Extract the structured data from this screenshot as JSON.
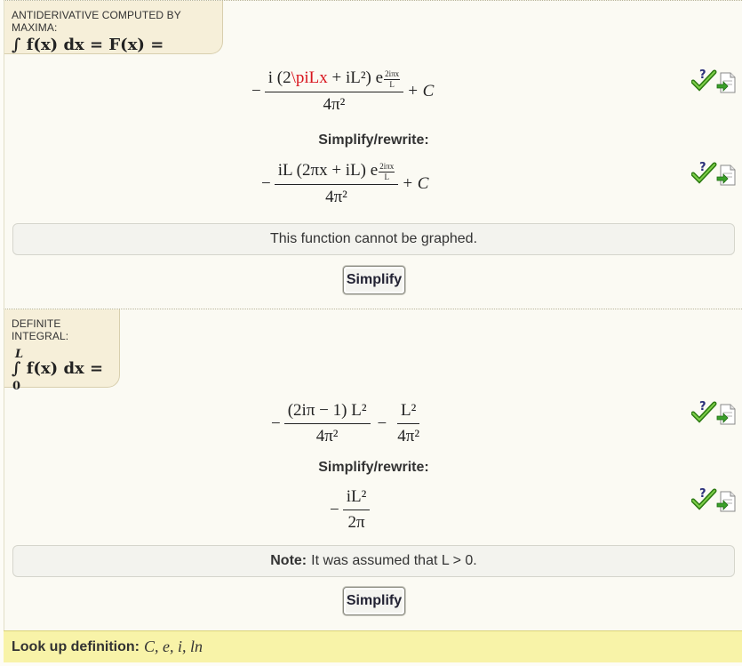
{
  "antiderivative": {
    "tag_label": "ANTIDERIVATIVE COMPUTED BY MAXIMA:",
    "tag_formula": "∫ f(x) dx = F(x) =",
    "result": {
      "minus": "−",
      "num_prefix": "i (2",
      "num_error": "\\piLx",
      "num_suffix": " + iL²) e",
      "exp_num": "2iπx",
      "exp_den": "L",
      "den": "4π²",
      "tail": "+ C"
    },
    "rewrite_label": "Simplify/rewrite:",
    "rewrite": {
      "minus": "−",
      "num": "iL (2πx + iL) e",
      "exp_num": "2iπx",
      "exp_den": "L",
      "den": "4π²",
      "tail": "+ C"
    },
    "notice": "This function cannot be graphed.",
    "simplify_button": "Simplify"
  },
  "definite": {
    "tag_label": "DEFINITE INTEGRAL:",
    "upper_limit": "L",
    "lower_limit": "0",
    "tag_formula": "∫ f(x) dx =",
    "result": {
      "minus": "−",
      "term1_num": "(2iπ − 1) L²",
      "term1_den": "4π²",
      "op": "−",
      "term2_num": "L²",
      "term2_den": "4π²"
    },
    "rewrite_label": "Simplify/rewrite:",
    "rewrite": {
      "minus": "−",
      "num": "iL²",
      "den": "2π"
    },
    "note_label": "Note:",
    "note_text": "It was assumed that L > 0.",
    "simplify_button": "Simplify"
  },
  "footer": {
    "label": "Look up definition:",
    "items": "C, e, i, ln"
  },
  "icons": {
    "check_color": "#3a8f1a",
    "question_color": "#2a2f7a"
  }
}
